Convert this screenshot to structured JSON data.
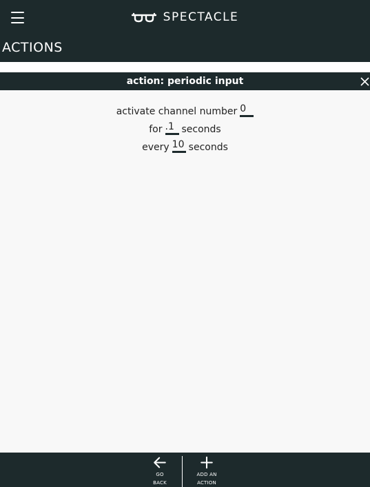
{
  "app": {
    "name": "SPECTACLE"
  },
  "page": {
    "title": "ACTIONS"
  },
  "action": {
    "title": "action: periodic input",
    "rows": [
      {
        "label_before": "activate channel number",
        "value": "0",
        "label_after": ""
      },
      {
        "label_before": "for",
        "value": ".1",
        "label_after": "seconds"
      },
      {
        "label_before": "every",
        "value": "10",
        "label_after": "seconds"
      }
    ]
  },
  "bottom_nav": {
    "back_line1": "GO",
    "back_line2": "BACK",
    "add_line1": "ADD AN",
    "add_line2": "ACTION"
  },
  "icons": {
    "menu": "hamburger-menu-icon",
    "logo": "glasses-logo-icon",
    "close": "close-icon",
    "back": "arrow-left-icon",
    "add": "plus-icon"
  },
  "colors": {
    "bar": "#1d2a2c",
    "background": "#f8f8f8",
    "text_light": "#ffffff",
    "text_dark": "#222222"
  }
}
